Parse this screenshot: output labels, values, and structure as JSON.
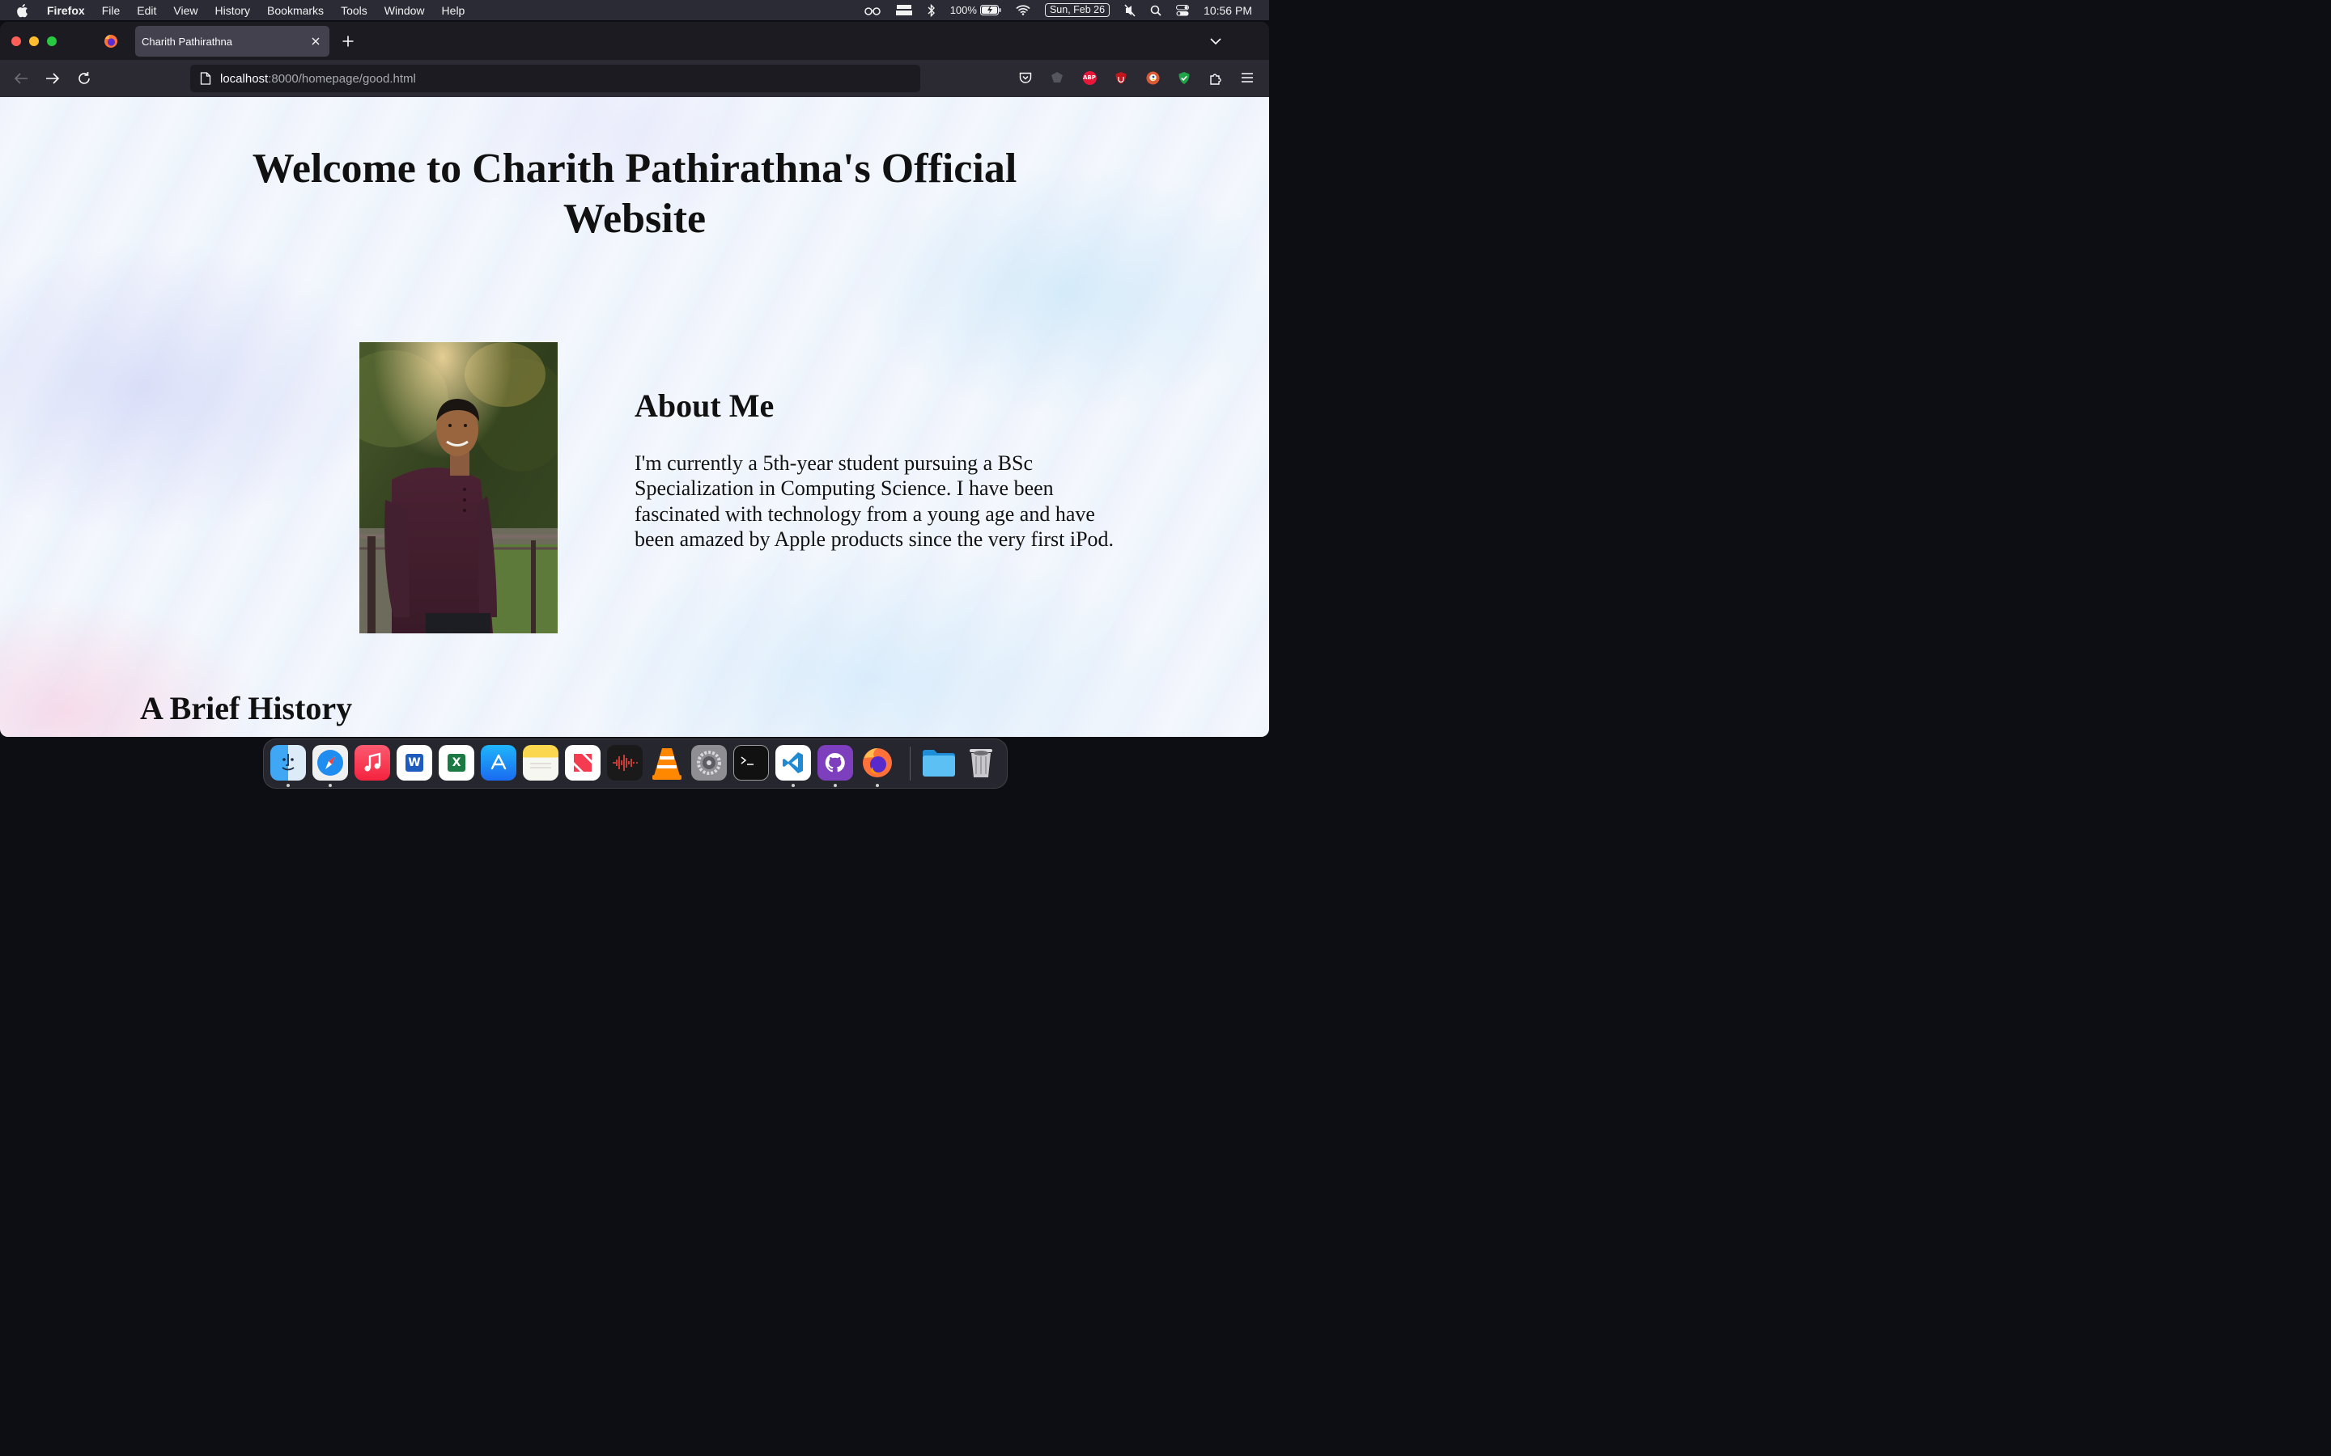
{
  "menubar": {
    "app_name": "Firefox",
    "menus": [
      "File",
      "Edit",
      "View",
      "History",
      "Bookmarks",
      "Tools",
      "Window",
      "Help"
    ],
    "battery": "100%",
    "date": "Sun, Feb 26",
    "time": "10:56 PM"
  },
  "browser": {
    "tab_title": "Charith Pathirathna",
    "url_host": "localhost",
    "url_path": ":8000/homepage/good.html",
    "extensions": [
      "pocket-icon",
      "adguard-icon",
      "adblock-plus-icon",
      "ublock-origin-icon",
      "duckduckgo-icon",
      "privacy-shield-icon",
      "extensions-icon",
      "menu-icon"
    ],
    "ext_badges": {
      "abp": "ABP"
    }
  },
  "page": {
    "title": "Welcome to Charith Pathirathna's Official Website",
    "about_heading": "About Me",
    "about_text": "I'm currently a 5th-year student pursuing a BSc Specialization in Computing Science. I have been fascinated with technology from a young age and have been amazed by Apple products since the very first iPod.",
    "history_heading": "A Brief History"
  },
  "dock": {
    "apps": [
      "Finder",
      "Safari",
      "Music",
      "Word",
      "Excel",
      "App Store",
      "Notes",
      "News",
      "Voice Memos",
      "VLC",
      "System Preferences",
      "Terminal",
      "Visual Studio Code",
      "GitHub Desktop",
      "Firefox",
      "Files",
      "Trash"
    ],
    "word_letter": "W",
    "excel_letter": "X"
  }
}
